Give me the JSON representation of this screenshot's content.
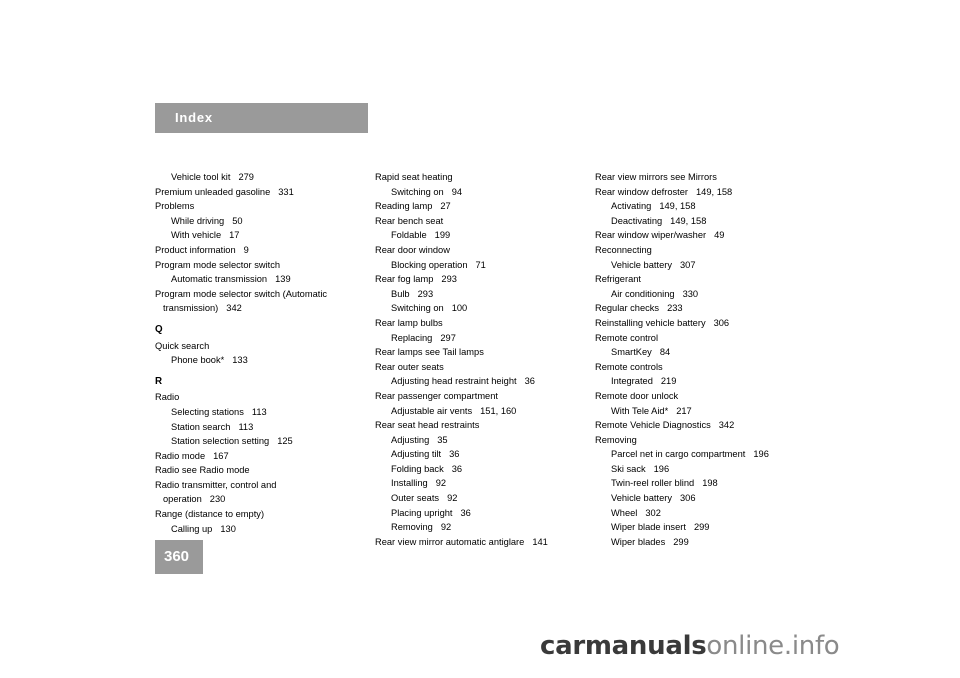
{
  "header": {
    "title": "Index"
  },
  "page_number": "360",
  "watermark": {
    "part1": "carmanuals",
    "part2": "online",
    "part3": ".info"
  },
  "columns": [
    {
      "entries": [
        {
          "level": 1,
          "text": "Vehicle tool kit",
          "page": "279"
        },
        {
          "level": 0,
          "text": "Premium unleaded gasoline",
          "page": "331"
        },
        {
          "level": 0,
          "text": "Problems",
          "page": ""
        },
        {
          "level": 1,
          "text": "While driving",
          "page": "50"
        },
        {
          "level": 1,
          "text": "With vehicle",
          "page": "17"
        },
        {
          "level": 0,
          "text": "Product information",
          "page": "9"
        },
        {
          "level": 0,
          "text": "Program mode selector switch",
          "page": ""
        },
        {
          "level": 1,
          "text": "Automatic transmission",
          "page": "139"
        },
        {
          "level": 0,
          "text": "Program mode selector switch (Automatic",
          "page": ""
        },
        {
          "level": 3,
          "text": "transmission)",
          "page": "342"
        },
        {
          "level": 9,
          "text": "Q",
          "page": ""
        },
        {
          "level": 0,
          "text": "Quick search",
          "page": ""
        },
        {
          "level": 1,
          "text": "Phone book*",
          "page": "133"
        },
        {
          "level": 9,
          "text": "R",
          "page": ""
        },
        {
          "level": 0,
          "text": "Radio",
          "page": ""
        },
        {
          "level": 1,
          "text": "Selecting stations",
          "page": "113"
        },
        {
          "level": 1,
          "text": "Station search",
          "page": "113"
        },
        {
          "level": 1,
          "text": "Station selection setting",
          "page": "125"
        },
        {
          "level": 0,
          "text": "Radio mode",
          "page": "167"
        },
        {
          "level": 0,
          "text": "Radio see Radio mode",
          "page": ""
        },
        {
          "level": 0,
          "text": "Radio transmitter, control and",
          "page": ""
        },
        {
          "level": 3,
          "text": "operation",
          "page": "230"
        },
        {
          "level": 0,
          "text": "Range (distance to empty)",
          "page": ""
        },
        {
          "level": 1,
          "text": "Calling up",
          "page": "130"
        }
      ]
    },
    {
      "entries": [
        {
          "level": 0,
          "text": "Rapid seat heating",
          "page": ""
        },
        {
          "level": 1,
          "text": "Switching on",
          "page": "94"
        },
        {
          "level": 0,
          "text": "Reading lamp",
          "page": "27"
        },
        {
          "level": 0,
          "text": "Rear bench seat",
          "page": ""
        },
        {
          "level": 1,
          "text": "Foldable",
          "page": "199"
        },
        {
          "level": 0,
          "text": "Rear door window",
          "page": ""
        },
        {
          "level": 1,
          "text": "Blocking operation",
          "page": "71"
        },
        {
          "level": 0,
          "text": "Rear fog lamp",
          "page": "293"
        },
        {
          "level": 1,
          "text": "Bulb",
          "page": "293"
        },
        {
          "level": 1,
          "text": "Switching on",
          "page": "100"
        },
        {
          "level": 0,
          "text": "Rear lamp bulbs",
          "page": ""
        },
        {
          "level": 1,
          "text": "Replacing",
          "page": "297"
        },
        {
          "level": 0,
          "text": "Rear lamps see Tail lamps",
          "page": ""
        },
        {
          "level": 0,
          "text": "Rear outer seats",
          "page": ""
        },
        {
          "level": 1,
          "text": "Adjusting head restraint height",
          "page": "36"
        },
        {
          "level": 0,
          "text": "Rear passenger compartment",
          "page": ""
        },
        {
          "level": 1,
          "text": "Adjustable air vents",
          "page": "151, 160"
        },
        {
          "level": 0,
          "text": "Rear seat head restraints",
          "page": ""
        },
        {
          "level": 1,
          "text": "Adjusting",
          "page": "35"
        },
        {
          "level": 1,
          "text": "Adjusting tilt",
          "page": "36"
        },
        {
          "level": 1,
          "text": "Folding back",
          "page": "36"
        },
        {
          "level": 1,
          "text": "Installing",
          "page": "92"
        },
        {
          "level": 1,
          "text": "Outer seats",
          "page": "92"
        },
        {
          "level": 1,
          "text": "Placing upright",
          "page": "36"
        },
        {
          "level": 1,
          "text": "Removing",
          "page": "92"
        },
        {
          "level": 0,
          "text": "Rear view mirror automatic antiglare",
          "page": "141"
        }
      ]
    },
    {
      "entries": [
        {
          "level": 0,
          "text": "Rear view mirrors see Mirrors",
          "page": ""
        },
        {
          "level": 0,
          "text": "Rear window defroster",
          "page": "149, 158"
        },
        {
          "level": 1,
          "text": "Activating",
          "page": "149, 158"
        },
        {
          "level": 1,
          "text": "Deactivating",
          "page": "149, 158"
        },
        {
          "level": 0,
          "text": "Rear window wiper/washer",
          "page": "49"
        },
        {
          "level": 0,
          "text": "Reconnecting",
          "page": ""
        },
        {
          "level": 1,
          "text": "Vehicle battery",
          "page": "307"
        },
        {
          "level": 0,
          "text": "Refrigerant",
          "page": ""
        },
        {
          "level": 1,
          "text": "Air conditioning",
          "page": "330"
        },
        {
          "level": 0,
          "text": "Regular checks",
          "page": "233"
        },
        {
          "level": 0,
          "text": "Reinstalling vehicle battery",
          "page": "306"
        },
        {
          "level": 0,
          "text": "Remote control",
          "page": ""
        },
        {
          "level": 1,
          "text": "SmartKey",
          "page": "84"
        },
        {
          "level": 0,
          "text": "Remote controls",
          "page": ""
        },
        {
          "level": 1,
          "text": "Integrated",
          "page": "219"
        },
        {
          "level": 0,
          "text": "Remote door unlock",
          "page": ""
        },
        {
          "level": 1,
          "text": "With Tele Aid*",
          "page": "217"
        },
        {
          "level": 0,
          "text": "Remote Vehicle Diagnostics",
          "page": "342"
        },
        {
          "level": 0,
          "text": "Removing",
          "page": ""
        },
        {
          "level": 1,
          "text": "Parcel net in cargo compartment",
          "page": "196"
        },
        {
          "level": 1,
          "text": "Ski sack",
          "page": "196"
        },
        {
          "level": 1,
          "text": "Twin-reel roller blind",
          "page": "198"
        },
        {
          "level": 1,
          "text": "Vehicle battery",
          "page": "306"
        },
        {
          "level": 1,
          "text": "Wheel",
          "page": "302"
        },
        {
          "level": 1,
          "text": "Wiper blade insert",
          "page": "299"
        },
        {
          "level": 1,
          "text": "Wiper blades",
          "page": "299"
        }
      ]
    }
  ]
}
